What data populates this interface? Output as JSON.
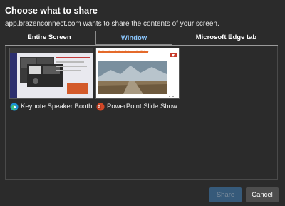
{
  "dialog": {
    "title": "Choose what to share",
    "subtitle": "app.brazenconnect.com wants to share the contents of your screen."
  },
  "tabs": [
    {
      "label": "Entire Screen",
      "selected": false
    },
    {
      "label": "Window",
      "selected": true
    },
    {
      "label": "Microsoft Edge tab",
      "selected": false
    }
  ],
  "windows": [
    {
      "label": "Keynote Speaker Booth...",
      "icon": "edge-icon"
    },
    {
      "label": "PowerPoint Slide Show...",
      "icon": "powerpoint-icon"
    }
  ],
  "slide_preview": {
    "title": "Petting Your Path: A Guide to the Future"
  },
  "buttons": {
    "share_label": "Share",
    "cancel_label": "Cancel"
  },
  "colors": {
    "background": "#2b2b2b",
    "selected_tab_text": "#8cc8ff",
    "share_button": "#365a7a",
    "cancel_button": "#4d4d4d"
  }
}
